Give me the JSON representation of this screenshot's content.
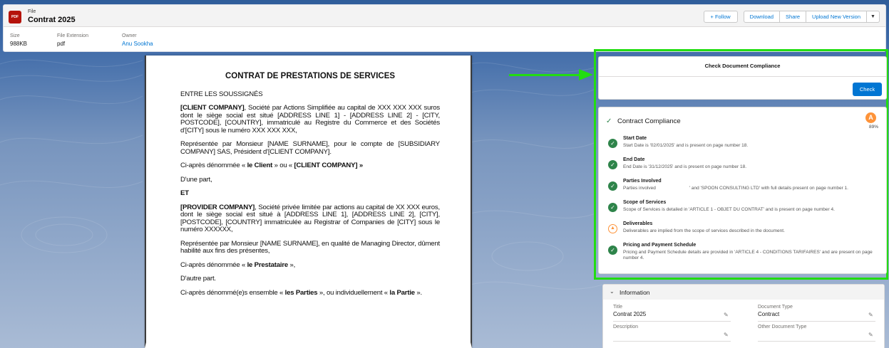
{
  "header": {
    "file_label": "File",
    "title": "Contrat 2025",
    "file_icon_text": "PDF",
    "buttons": {
      "follow": "+ Follow",
      "download": "Download",
      "share": "Share",
      "upload": "Upload New Version"
    },
    "meta": [
      {
        "label": "Size",
        "value": "988KB"
      },
      {
        "label": "File Extension",
        "value": "pdf"
      },
      {
        "label": "Owner",
        "value": "Anu Sookha"
      }
    ]
  },
  "document": {
    "title": "CONTRAT DE PRESTATIONS DE SERVICES",
    "p1": "ENTRE LES SOUSSIGNÉS",
    "p2_bold": "[CLIENT COMPANY]",
    "p2_rest": ", Société par Actions Simplifiée au capital de XXX XXX XXX suros dont le siège social est situé [ADDRESS LINE 1] - [ADDRESS LINE 2] - [CITY, POSTCODE], [COUNTRY], immatriculé au Registre du Commerce et des Sociétés d'[CITY] sous le numéro XXX XXX XXX,",
    "p3": "Représentée par Monsieur [NAME SURNAME], pour le compte de [SUBSIDIARY COMPANY] SAS, Président d'[CLIENT COMPANY].",
    "p4_a": "Ci-après dénommée « ",
    "p4_b": "le Client",
    "p4_c": " » ou « ",
    "p4_d": "[CLIENT COMPANY] »",
    "p5": "D'une part,",
    "p6": "ET",
    "p7_bold": "[PROVIDER COMPANY]",
    "p7_rest": ", Société privée limitée par actions au capital de XX XXX euros, dont le siège social est situé à [ADDRESS LINE 1], [ADDRESS LINE 2], [CITY], [POSTCODE], [COUNTRY] immatriculée au Registrar of Companies de [CITY] sous le numéro XXXXXX,",
    "p8": "Représentée par Monsieur [NAME SURNAME], en qualité de Managing Director, dûment habilité aux fins des présentes,",
    "p9_a": "Ci-après dénommée « ",
    "p9_b": "le Prestataire",
    "p9_c": " »,",
    "p10": "D'autre part.",
    "p11_a": "Ci-après dénommé(e)s ensemble « ",
    "p11_b": "les Parties",
    "p11_c": " », ou individuellement « ",
    "p11_d": "la Partie",
    "p11_e": " »."
  },
  "check_panel": {
    "title": "Check Document Compliance",
    "button": "Check"
  },
  "compliance": {
    "title": "Contract Compliance",
    "score_icon": "A",
    "score": "89%",
    "items": [
      {
        "status": "pass",
        "title": "Start Date",
        "desc": "Start Date is '02/01/2025' and is present on page number 18."
      },
      {
        "status": "pass",
        "title": "End Date",
        "desc": "End Date is '31/12/2025' and is present on page number 18."
      },
      {
        "status": "pass",
        "title": "Parties Involved",
        "desc": "Parties involved                          ' and 'SPOON CONSULTING LTD' with full details present on page number 1."
      },
      {
        "status": "pass",
        "title": "Scope of Services",
        "desc": "Scope of Services is detailed in 'ARTICLE 1 - OBJET DU CONTRAT' and is present on page number 4."
      },
      {
        "status": "warn",
        "title": "Deliverables",
        "desc": "Deliverables are implied from the scope of services described in the document."
      },
      {
        "status": "pass",
        "title": "Pricing and Payment Schedule",
        "desc": "Pricing and Payment Schedule details are provided in 'ARTICLE 4 - CONDITIONS TARIFAIRES' and are present on page number 4."
      }
    ]
  },
  "information": {
    "title": "Information",
    "fields": {
      "title_label": "Title",
      "title_value": "Contrat 2025",
      "doc_type_label": "Document Type",
      "doc_type_value": "Contract",
      "description_label": "Description",
      "description_value": "",
      "other_doc_type_label": "Other Document Type",
      "other_doc_type_value": ""
    }
  },
  "colors": {
    "brand_blue": "#0176d3",
    "success_green": "#2e844a",
    "warning_orange": "#fe9339",
    "annotation_green": "#22dd11",
    "pdf_red": "#b5130b"
  }
}
